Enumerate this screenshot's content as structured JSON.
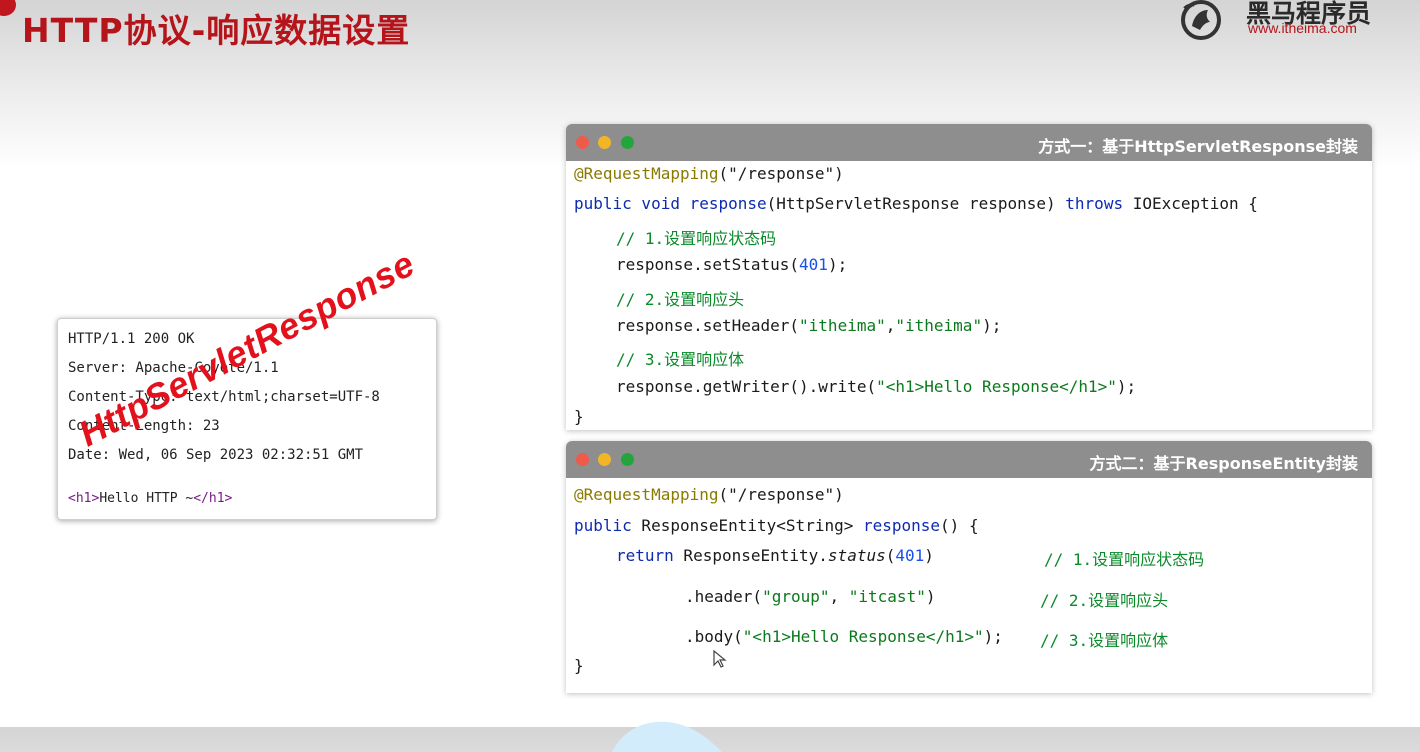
{
  "header": {
    "title": "HTTP协议-响应数据设置",
    "logo_name": "黑马程序员",
    "logo_url": "www.itheima.com"
  },
  "http_response": {
    "lines": [
      "HTTP/1.1 200 OK",
      "Server: Apache-Coyote/1.1",
      "Content-Type: text/html;charset=UTF-8",
      "Content-Length: 23",
      "Date: Wed, 06 Sep 2023 02:32:51 GMT"
    ],
    "body_open_tag": "<h1>",
    "body_text": "Hello HTTP ~",
    "body_close_tag": "</h1>",
    "stamp": "HttpServletResponse"
  },
  "method_one": {
    "title": "方式一：基于HttpServletResponse封装",
    "annotation": "@RequestMapping",
    "path": "(\"/response\")",
    "sig_public": "public",
    "sig_void": " void ",
    "sig_name": "response",
    "sig_params": "(HttpServletResponse response) ",
    "sig_throws": "throws",
    "sig_exception": " IOException {",
    "c1": "// 1.设置响应状态码",
    "s1_pre": "response.setStatus(",
    "s1_num": "401",
    "s1_post": ");",
    "c2": "// 2.设置响应头",
    "s2_pre": "response.setHeader(",
    "s2_a": "\"itheima\"",
    "s2_comma": ",",
    "s2_b": "\"itheima\"",
    "s2_post": ");",
    "c3": "// 3.设置响应体",
    "s3_pre": "response.getWriter().write(",
    "s3_str": "\"<h1>Hello Response</h1>\"",
    "s3_post": ");",
    "close": "}"
  },
  "method_two": {
    "title": "方式二：基于ResponseEntity封装",
    "annotation": "@RequestMapping",
    "path": "(\"/response\")",
    "sig_public": "public",
    "sig_type": " ResponseEntity<String> ",
    "sig_name": "response",
    "sig_rest": "() {",
    "r_kw": "return",
    "r_pre": " ResponseEntity.",
    "r_status": "status",
    "r_open": "(",
    "r_num": "401",
    "r_close": ")",
    "c1": "// 1.设置响应状态码",
    "h_pre": ".header(",
    "h_a": "\"group\"",
    "h_comma": ", ",
    "h_b": "\"itcast\"",
    "h_post": ")",
    "c2": "// 2.设置响应头",
    "b_pre": ".body(",
    "b_str": "\"<h1>Hello Response</h1>\"",
    "b_post": ");",
    "c3": "// 3.设置响应体",
    "close": "}"
  }
}
